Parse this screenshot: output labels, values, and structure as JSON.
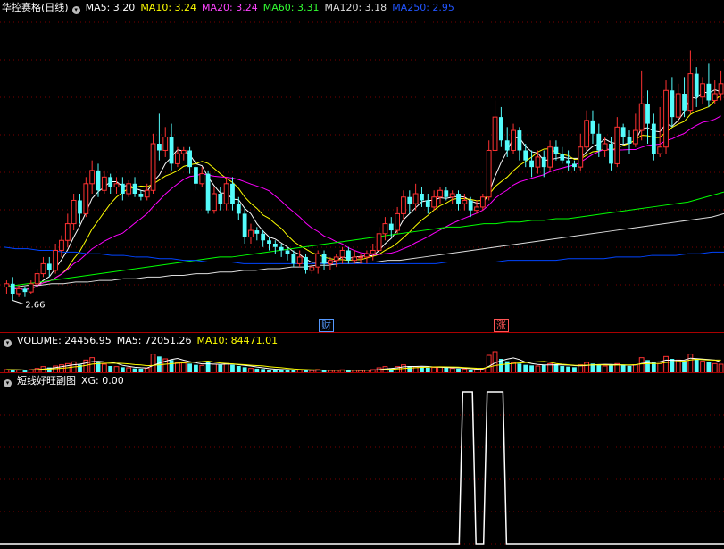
{
  "header": {
    "stock_name": "华控赛格(日线)",
    "ma": [
      {
        "label": "MA5: 3.20",
        "color": "#ffffff"
      },
      {
        "label": "MA10: 3.24",
        "color": "#ffff00"
      },
      {
        "label": "MA20: 3.24",
        "color": "#ff00ff"
      },
      {
        "label": "MA60: 3.31",
        "color": "#00ff00"
      },
      {
        "label": "MA120: 3.18",
        "color": "#dddddd"
      },
      {
        "label": "MA250: 2.95",
        "color": "#0044ff"
      }
    ]
  },
  "price_panel": {
    "low_label": "2.66",
    "event_tags": [
      {
        "text": "财",
        "color": "#5599ff"
      },
      {
        "text": "涨",
        "color": "#ff5555"
      }
    ]
  },
  "volume_panel": {
    "title": "VOLUME: 24456.95",
    "ma5": "MA5: 72051.26",
    "ma10": "MA10: 84471.01"
  },
  "indicator_panel": {
    "title": "短线好旺副图",
    "xg": "XG: 0.00"
  },
  "colors": {
    "up": "#ff3232",
    "down": "#54fcfc",
    "grid": "#7a0000",
    "axis": "#aa0000"
  },
  "chart_data": {
    "type": "candlestick",
    "note_units": "price in CNY",
    "ylim": [
      2.55,
      4.35
    ],
    "candles": [
      [
        2.74,
        2.76,
        2.7,
        2.78
      ],
      [
        2.76,
        2.7,
        2.66,
        2.8
      ],
      [
        2.7,
        2.73,
        2.68,
        2.75
      ],
      [
        2.73,
        2.71,
        2.68,
        2.74
      ],
      [
        2.71,
        2.76,
        2.7,
        2.78
      ],
      [
        2.76,
        2.82,
        2.74,
        2.85
      ],
      [
        2.82,
        2.88,
        2.8,
        2.92
      ],
      [
        2.88,
        2.84,
        2.8,
        2.92
      ],
      [
        2.84,
        2.96,
        2.82,
        3.0
      ],
      [
        2.96,
        3.02,
        2.92,
        3.05
      ],
      [
        3.02,
        3.12,
        2.98,
        3.18
      ],
      [
        3.12,
        3.26,
        3.08,
        3.3
      ],
      [
        3.26,
        3.18,
        3.12,
        3.3
      ],
      [
        3.18,
        3.36,
        3.16,
        3.4
      ],
      [
        3.36,
        3.44,
        3.3,
        3.5
      ],
      [
        3.44,
        3.32,
        3.28,
        3.48
      ],
      [
        3.32,
        3.4,
        3.3,
        3.44
      ],
      [
        3.4,
        3.34,
        3.3,
        3.42
      ],
      [
        3.34,
        3.36,
        3.3,
        3.4
      ],
      [
        3.36,
        3.3,
        3.26,
        3.4
      ],
      [
        3.3,
        3.36,
        3.28,
        3.38
      ],
      [
        3.36,
        3.3,
        3.28,
        3.4
      ],
      [
        3.3,
        3.28,
        3.26,
        3.32
      ],
      [
        3.28,
        3.32,
        3.26,
        3.36
      ],
      [
        3.32,
        3.6,
        3.3,
        3.66
      ],
      [
        3.6,
        3.56,
        3.5,
        3.78
      ],
      [
        3.56,
        3.64,
        3.52,
        3.7
      ],
      [
        3.64,
        3.48,
        3.44,
        3.72
      ],
      [
        3.48,
        3.54,
        3.46,
        3.58
      ],
      [
        3.54,
        3.56,
        3.5,
        3.58
      ],
      [
        3.56,
        3.46,
        3.42,
        3.58
      ],
      [
        3.46,
        3.36,
        3.32,
        3.5
      ],
      [
        3.36,
        3.42,
        3.34,
        3.46
      ],
      [
        3.42,
        3.2,
        3.18,
        3.44
      ],
      [
        3.2,
        3.3,
        3.18,
        3.34
      ],
      [
        3.3,
        3.24,
        3.2,
        3.34
      ],
      [
        3.24,
        3.36,
        3.2,
        3.4
      ],
      [
        3.36,
        3.24,
        3.2,
        3.4
      ],
      [
        3.24,
        3.18,
        3.14,
        3.28
      ],
      [
        3.18,
        3.04,
        3.0,
        3.22
      ],
      [
        3.04,
        3.08,
        3.0,
        3.12
      ],
      [
        3.08,
        3.06,
        3.02,
        3.1
      ],
      [
        3.06,
        3.02,
        2.98,
        3.08
      ],
      [
        3.02,
        3.0,
        2.96,
        3.04
      ],
      [
        3.0,
        2.98,
        2.94,
        3.02
      ],
      [
        2.98,
        2.96,
        2.92,
        3.0
      ],
      [
        2.96,
        2.94,
        2.9,
        2.98
      ],
      [
        2.94,
        2.88,
        2.86,
        2.96
      ],
      [
        2.88,
        2.92,
        2.86,
        2.96
      ],
      [
        2.92,
        2.84,
        2.82,
        2.94
      ],
      [
        2.84,
        2.86,
        2.82,
        2.88
      ],
      [
        2.86,
        2.94,
        2.82,
        2.96
      ],
      [
        2.94,
        2.88,
        2.84,
        2.96
      ],
      [
        2.88,
        2.9,
        2.84,
        2.92
      ],
      [
        2.9,
        2.92,
        2.86,
        2.94
      ],
      [
        2.92,
        2.96,
        2.88,
        2.98
      ],
      [
        2.96,
        2.9,
        2.88,
        2.98
      ],
      [
        2.9,
        2.92,
        2.88,
        2.96
      ],
      [
        2.92,
        2.92,
        2.88,
        2.94
      ],
      [
        2.92,
        2.94,
        2.88,
        2.96
      ],
      [
        2.94,
        2.96,
        2.9,
        3.0
      ],
      [
        2.96,
        3.06,
        2.94,
        3.1
      ],
      [
        3.06,
        3.12,
        3.02,
        3.16
      ],
      [
        3.12,
        3.08,
        3.04,
        3.16
      ],
      [
        3.08,
        3.18,
        3.06,
        3.22
      ],
      [
        3.18,
        3.28,
        3.14,
        3.32
      ],
      [
        3.28,
        3.24,
        3.18,
        3.32
      ],
      [
        3.24,
        3.3,
        3.2,
        3.36
      ],
      [
        3.3,
        3.26,
        3.22,
        3.34
      ],
      [
        3.26,
        3.22,
        3.18,
        3.3
      ],
      [
        3.22,
        3.28,
        3.2,
        3.32
      ],
      [
        3.28,
        3.32,
        3.24,
        3.34
      ],
      [
        3.32,
        3.28,
        3.26,
        3.34
      ],
      [
        3.28,
        3.3,
        3.24,
        3.32
      ],
      [
        3.3,
        3.24,
        3.2,
        3.32
      ],
      [
        3.24,
        3.26,
        3.2,
        3.3
      ],
      [
        3.26,
        3.2,
        3.16,
        3.28
      ],
      [
        3.2,
        3.22,
        3.18,
        3.26
      ],
      [
        3.22,
        3.28,
        3.2,
        3.3
      ],
      [
        3.28,
        3.56,
        3.26,
        3.62
      ],
      [
        3.56,
        3.76,
        3.54,
        3.86
      ],
      [
        3.76,
        3.62,
        3.58,
        3.82
      ],
      [
        3.62,
        3.56,
        3.52,
        3.7
      ],
      [
        3.56,
        3.68,
        3.54,
        3.72
      ],
      [
        3.68,
        3.56,
        3.5,
        3.7
      ],
      [
        3.56,
        3.5,
        3.46,
        3.6
      ],
      [
        3.5,
        3.46,
        3.4,
        3.56
      ],
      [
        3.46,
        3.52,
        3.42,
        3.56
      ],
      [
        3.52,
        3.46,
        3.4,
        3.56
      ],
      [
        3.46,
        3.58,
        3.44,
        3.62
      ],
      [
        3.58,
        3.54,
        3.5,
        3.62
      ],
      [
        3.54,
        3.5,
        3.48,
        3.58
      ],
      [
        3.5,
        3.48,
        3.44,
        3.56
      ],
      [
        3.48,
        3.46,
        3.44,
        3.5
      ],
      [
        3.46,
        3.58,
        3.44,
        3.66
      ],
      [
        3.58,
        3.74,
        3.56,
        3.8
      ],
      [
        3.74,
        3.66,
        3.6,
        3.8
      ],
      [
        3.66,
        3.56,
        3.52,
        3.72
      ],
      [
        3.56,
        3.6,
        3.52,
        3.64
      ],
      [
        3.6,
        3.48,
        3.44,
        3.64
      ],
      [
        3.48,
        3.7,
        3.46,
        3.76
      ],
      [
        3.7,
        3.64,
        3.6,
        3.72
      ],
      [
        3.64,
        3.6,
        3.54,
        3.68
      ],
      [
        3.6,
        3.68,
        3.58,
        3.78
      ],
      [
        3.68,
        3.84,
        3.62,
        4.04
      ],
      [
        3.84,
        3.72,
        3.6,
        3.92
      ],
      [
        3.72,
        3.54,
        3.5,
        3.78
      ],
      [
        3.54,
        3.58,
        3.52,
        3.82
      ],
      [
        3.58,
        3.92,
        3.54,
        3.98
      ],
      [
        3.92,
        3.76,
        3.7,
        4.0
      ],
      [
        3.76,
        3.9,
        3.72,
        3.96
      ],
      [
        3.9,
        3.8,
        3.76,
        4.0
      ],
      [
        3.8,
        4.02,
        3.78,
        4.16
      ],
      [
        4.02,
        3.88,
        3.82,
        4.06
      ],
      [
        3.88,
        3.96,
        3.84,
        4.0
      ],
      [
        3.96,
        3.86,
        3.82,
        4.08
      ],
      [
        3.86,
        3.9,
        3.84,
        3.98
      ],
      [
        3.9,
        3.96,
        3.86,
        4.04
      ]
    ],
    "ma_lines": [
      {
        "name": "MA5",
        "color": "#ffffff",
        "period": 5
      },
      {
        "name": "MA10",
        "color": "#ffff00",
        "period": 10
      },
      {
        "name": "MA20",
        "color": "#ff00ff",
        "period": 20
      },
      {
        "name": "MA60",
        "color": "#00ff00",
        "values": [
          2.74,
          2.75,
          2.76,
          2.77,
          2.78,
          2.79,
          2.8,
          2.81,
          2.82,
          2.83,
          2.84,
          2.85,
          2.86,
          2.87,
          2.88,
          2.89,
          2.9,
          2.91,
          2.92,
          2.92,
          2.93,
          2.94,
          2.95,
          2.96,
          2.97,
          2.98,
          2.99,
          3.0,
          3.01,
          3.02,
          3.03,
          3.04,
          3.05,
          3.06,
          3.07,
          3.08,
          3.09,
          3.1,
          3.1,
          3.11,
          3.12,
          3.12,
          3.13,
          3.13,
          3.14,
          3.14,
          3.15,
          3.15,
          3.16,
          3.17,
          3.18,
          3.19,
          3.2,
          3.21,
          3.22,
          3.23,
          3.24,
          3.25,
          3.27,
          3.29,
          3.31
        ]
      },
      {
        "name": "MA120",
        "color": "#dddddd",
        "values": [
          2.74,
          2.74,
          2.75,
          2.75,
          2.76,
          2.76,
          2.77,
          2.77,
          2.78,
          2.78,
          2.79,
          2.79,
          2.8,
          2.8,
          2.81,
          2.81,
          2.82,
          2.82,
          2.83,
          2.83,
          2.84,
          2.84,
          2.85,
          2.85,
          2.86,
          2.86,
          2.87,
          2.87,
          2.88,
          2.88,
          2.89,
          2.89,
          2.9,
          2.9,
          2.91,
          2.92,
          2.93,
          2.94,
          2.95,
          2.96,
          2.97,
          2.98,
          2.99,
          3.0,
          3.01,
          3.02,
          3.03,
          3.04,
          3.05,
          3.06,
          3.07,
          3.08,
          3.09,
          3.1,
          3.11,
          3.12,
          3.13,
          3.14,
          3.15,
          3.16,
          3.18
        ]
      },
      {
        "name": "MA250",
        "color": "#0044ff",
        "values": [
          2.98,
          2.97,
          2.97,
          2.96,
          2.96,
          2.95,
          2.95,
          2.94,
          2.94,
          2.93,
          2.93,
          2.92,
          2.92,
          2.91,
          2.91,
          2.9,
          2.9,
          2.89,
          2.89,
          2.89,
          2.88,
          2.88,
          2.88,
          2.88,
          2.88,
          2.88,
          2.88,
          2.88,
          2.88,
          2.88,
          2.88,
          2.88,
          2.88,
          2.88,
          2.88,
          2.88,
          2.88,
          2.89,
          2.89,
          2.89,
          2.89,
          2.89,
          2.9,
          2.9,
          2.9,
          2.9,
          2.9,
          2.91,
          2.91,
          2.91,
          2.91,
          2.92,
          2.92,
          2.92,
          2.93,
          2.93,
          2.93,
          2.94,
          2.94,
          2.95,
          2.95
        ]
      }
    ],
    "volume": [
      30,
      28,
      25,
      22,
      30,
      40,
      55,
      48,
      60,
      70,
      80,
      95,
      70,
      110,
      130,
      90,
      75,
      60,
      55,
      50,
      45,
      40,
      38,
      42,
      160,
      140,
      120,
      110,
      90,
      85,
      80,
      70,
      65,
      90,
      75,
      70,
      80,
      70,
      60,
      50,
      40,
      38,
      35,
      30,
      28,
      26,
      25,
      24,
      26,
      24,
      22,
      30,
      26,
      24,
      25,
      28,
      24,
      25,
      22,
      26,
      30,
      45,
      55,
      42,
      55,
      70,
      60,
      55,
      50,
      45,
      48,
      52,
      45,
      40,
      38,
      35,
      30,
      32,
      40,
      150,
      180,
      120,
      100,
      90,
      80,
      70,
      65,
      60,
      70,
      80,
      75,
      60,
      55,
      50,
      70,
      90,
      80,
      70,
      60,
      65,
      80,
      70,
      60,
      70,
      130,
      110,
      90,
      80,
      140,
      120,
      110,
      100,
      160,
      120,
      100,
      90,
      80,
      75
    ],
    "volume_ma_colors": {
      "ma5": "#ffffff",
      "ma10": "#ffff00"
    },
    "xg_signal": {
      "ylim": [
        0,
        1
      ],
      "spikes": [
        [
          75,
          76
        ],
        [
          79,
          81
        ]
      ]
    }
  }
}
